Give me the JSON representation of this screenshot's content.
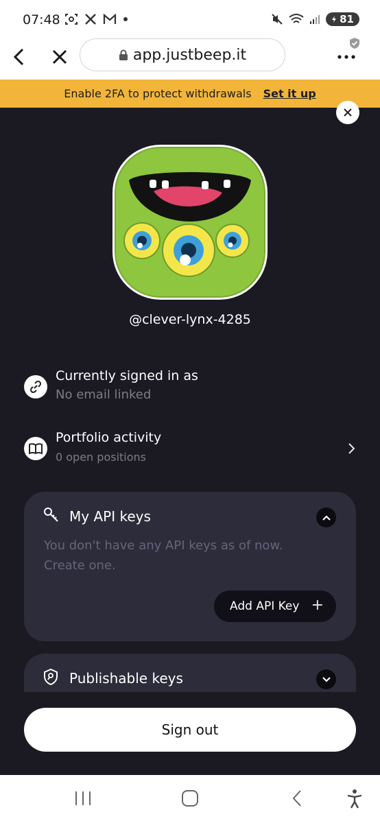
{
  "status_bar": {
    "time": "07:48",
    "battery": "81",
    "left_icons": [
      "screenshot-icon",
      "x-logo-icon",
      "gmail-icon",
      "dot-icon"
    ],
    "right_icons": [
      "mute-icon",
      "wifi-icon",
      "signal-icon",
      "battery-icon"
    ]
  },
  "browser": {
    "url": "app.justbeep.it",
    "back_icon": "chevron-left-icon",
    "close_icon": "close-icon",
    "menu_icon": "more-vertical-icon"
  },
  "banner": {
    "message": "Enable 2FA to protect withdrawals",
    "link": "Set it up",
    "color": "#f2b53a"
  },
  "profile": {
    "username": "@clever-lynx-4285"
  },
  "rows": {
    "signed_in": {
      "title": "Currently signed in as",
      "subtitle": "No email linked",
      "icon": "link-icon"
    },
    "portfolio": {
      "title": "Portfolio activity",
      "subtitle": "0 open positions",
      "icon": "book-icon"
    }
  },
  "api_keys": {
    "title": "My API keys",
    "empty_text": "You don't have any API keys as of now. Create one.",
    "add_button": "Add API Key",
    "add_icon": "+",
    "expanded": true
  },
  "publishable_keys": {
    "title": "Publishable keys",
    "expanded": false
  },
  "sign_out": "Sign out",
  "colors": {
    "sheet_bg": "#1b1a23",
    "card_bg": "#2d2c3a",
    "muted_text": "#7d7c86",
    "banner": "#f2b53a"
  },
  "android_nav": [
    "recents-icon",
    "home-icon",
    "back-icon",
    "accessibility-icon"
  ]
}
